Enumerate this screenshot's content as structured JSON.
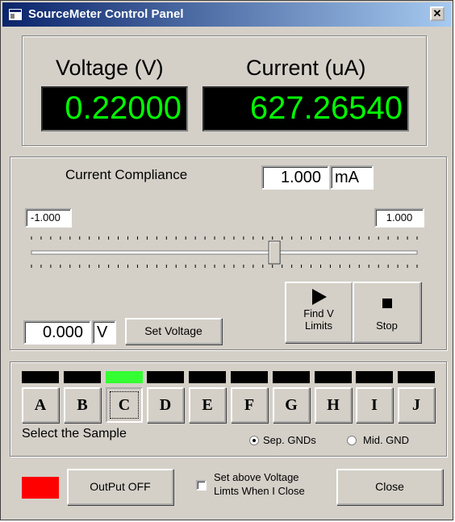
{
  "window": {
    "title": "SourceMeter Control Panel",
    "close_glyph": "✕"
  },
  "readout": {
    "voltage_label": "Voltage (V)",
    "voltage_value": "0.22000",
    "current_label": "Current (uA)",
    "current_value": "627.26540",
    "display_color": "#00ff00"
  },
  "compliance": {
    "label": "Current Compliance",
    "value": "1.000",
    "unit": "mA"
  },
  "slider": {
    "min_value": "-1.000",
    "max_value": "1.000",
    "position_fraction": 0.63
  },
  "voltage": {
    "value": "0.000",
    "unit": "V",
    "set_button": "Set Voltage"
  },
  "actions": {
    "find_label_1": "Find V",
    "find_label_2": "Limits",
    "stop_label": "Stop",
    "play_icon": "play-icon",
    "stop_icon": "stop-icon"
  },
  "samples": {
    "letters": [
      "A",
      "B",
      "C",
      "D",
      "E",
      "F",
      "G",
      "H",
      "I",
      "J"
    ],
    "selected": "C",
    "prompt": "Select the Sample",
    "ground_options": [
      {
        "label": "Sep. GNDs",
        "checked": true
      },
      {
        "label": "Mid. GND",
        "checked": false
      }
    ],
    "active_color": "#33ff33"
  },
  "footer": {
    "output_indicator_color": "#ff0000",
    "output_button": "OutPut OFF",
    "checkbox_line1": "Set above Voltage",
    "checkbox_line2": "Limts When I Close",
    "checkbox_checked": false,
    "close_button": "Close"
  }
}
